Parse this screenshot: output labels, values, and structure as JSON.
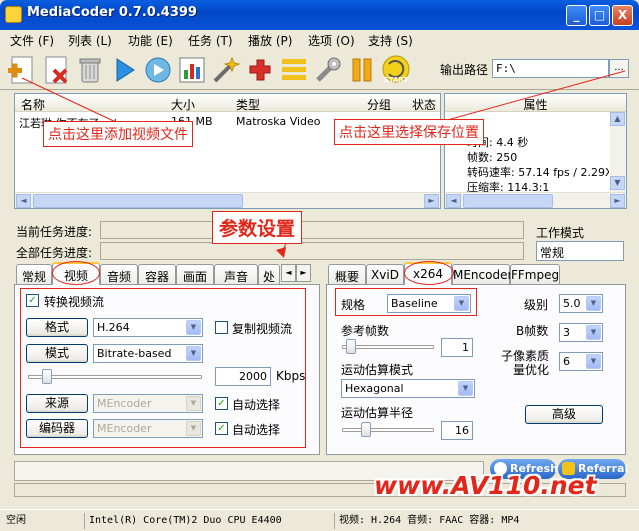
{
  "window": {
    "title": "MediaCoder 0.7.0.4399",
    "min": "_",
    "max": "□",
    "close": "X"
  },
  "menu": [
    {
      "label": "文件 (F)"
    },
    {
      "label": "列表 (L)"
    },
    {
      "label": "功能 (E)"
    },
    {
      "label": "任务 (T)"
    },
    {
      "label": "播放 (P)"
    },
    {
      "label": "选项 (O)"
    },
    {
      "label": "支持 (S)"
    }
  ],
  "toolbar": {
    "start_label": "START",
    "output_path_label": "输出路径",
    "output_path_value": "F:\\",
    "browse_label": "..."
  },
  "file_list": {
    "columns": [
      "名称",
      "大小",
      "类型",
      "分组",
      "状态"
    ],
    "rows": [
      {
        "name": "江若琳 你不在了.mkv",
        "size": "161 MB",
        "type": "Matroska Video"
      }
    ]
  },
  "properties": {
    "header": "属性",
    "rows": [
      "时间: 4.4 秒",
      "帧数: 250",
      "转码速率: 57.14 fps / 2.29X",
      "压缩率: 114.3:1"
    ]
  },
  "progress": {
    "current_label": "当前任务进度:",
    "total_label": "全部任务进度:",
    "work_mode_label": "工作模式",
    "work_mode_value": "常规"
  },
  "annotations": {
    "add_file": "点击这里添加视频文件",
    "save_location": "点击这里选择保存位置",
    "params": "参数设置"
  },
  "left_tabs": [
    "常规",
    "视频",
    "音频",
    "容器",
    "画面",
    "声音",
    "处"
  ],
  "video": {
    "enable_label": "转换视频流",
    "format_button": "格式",
    "format_value": "H.264",
    "copy_stream_label": "复制视频流",
    "mode_button": "模式",
    "mode_value": "Bitrate-based",
    "bitrate_value": "2000",
    "bitrate_unit": "Kbps",
    "source_button": "来源",
    "source_value": "MEncoder",
    "source_auto_label": "自动选择",
    "encoder_button": "编码器",
    "encoder_value": "MEncoder",
    "encoder_auto_label": "自动选择"
  },
  "right_tabs": [
    "概要",
    "XviD",
    "x264",
    "MEncoder",
    "FFmpeg"
  ],
  "x264": {
    "profile_label": "规格",
    "profile_value": "Baseline",
    "level_label": "级别",
    "level_value": "5.0",
    "ref_label": "参考帧数",
    "ref_value": "1",
    "bframes_label": "B帧数",
    "bframes_value": "3",
    "subme_label1": "子像素质",
    "subme_label2": "量优化",
    "subme_value": "6",
    "me_label": "运动估算模式",
    "me_value": "Hexagonal",
    "merange_label": "运动估算半径",
    "merange_value": "16",
    "advanced_button": "高级"
  },
  "buttons": {
    "refresh": "Refresh",
    "referral": "Referral"
  },
  "watermark": "www.AV110.net",
  "status": {
    "state": "空闲",
    "cpu": "Intel(R) Core(TM)2 Duo CPU E4400",
    "summary": "视频: H.264  音频: FAAC  容器: MP4"
  },
  "colors": {
    "accent": "#E2261A",
    "titlebar": "#0047C8"
  }
}
